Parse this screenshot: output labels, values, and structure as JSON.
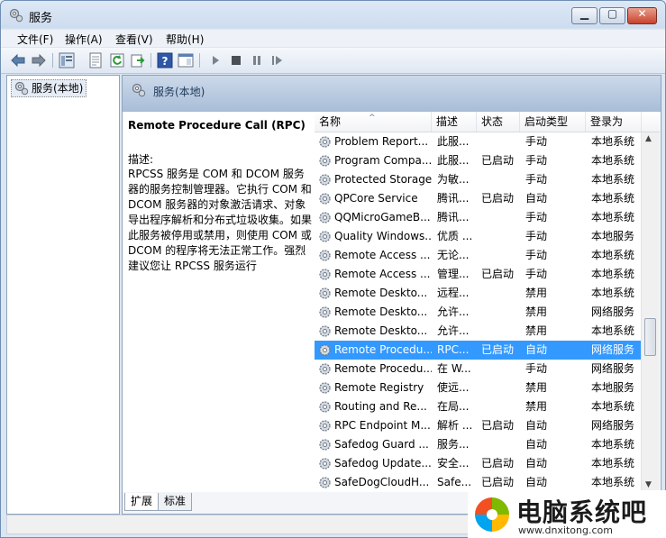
{
  "window": {
    "title": "服务"
  },
  "menu": [
    "文件(F)",
    "操作(A)",
    "查看(V)",
    "帮助(H)"
  ],
  "tree": {
    "label": "服务(本地)"
  },
  "pane_header": "服务(本地)",
  "description": {
    "title": "Remote Procedure Call (RPC)",
    "label": "描述:",
    "body": "RPCSS 服务是 COM 和 DCOM 服务器的服务控制管理器。它执行 COM 和 DCOM 服务器的对象激活请求、对象导出程序解析和分布式垃圾收集。如果此服务被停用或禁用，则使用 COM 或 DCOM 的程序将无法正常工作。强烈建议您让 RPCSS 服务运行"
  },
  "columns": {
    "name": "名称",
    "desc": "描述",
    "status": "状态",
    "startup": "启动类型",
    "logon": "登录为"
  },
  "rows": [
    {
      "name": "Problem Report...",
      "desc": "此服...",
      "status": "",
      "startup": "手动",
      "logon": "本地系统"
    },
    {
      "name": "Program Compa...",
      "desc": "此服...",
      "status": "已启动",
      "startup": "手动",
      "logon": "本地系统"
    },
    {
      "name": "Protected Storage",
      "desc": "为敏...",
      "status": "",
      "startup": "手动",
      "logon": "本地系统"
    },
    {
      "name": "QPCore Service",
      "desc": "腾讯...",
      "status": "已启动",
      "startup": "自动",
      "logon": "本地系统"
    },
    {
      "name": "QQMicroGameB...",
      "desc": "腾讯...",
      "status": "",
      "startup": "手动",
      "logon": "本地系统"
    },
    {
      "name": "Quality Windows...",
      "desc": "优质 ...",
      "status": "",
      "startup": "手动",
      "logon": "本地服务"
    },
    {
      "name": "Remote Access ...",
      "desc": "无论...",
      "status": "",
      "startup": "手动",
      "logon": "本地系统"
    },
    {
      "name": "Remote Access ...",
      "desc": "管理...",
      "status": "已启动",
      "startup": "手动",
      "logon": "本地系统"
    },
    {
      "name": "Remote Deskto...",
      "desc": "远程...",
      "status": "",
      "startup": "禁用",
      "logon": "本地系统"
    },
    {
      "name": "Remote Deskto...",
      "desc": "允许...",
      "status": "",
      "startup": "禁用",
      "logon": "网络服务"
    },
    {
      "name": "Remote Deskto...",
      "desc": "允许...",
      "status": "",
      "startup": "禁用",
      "logon": "本地系统"
    },
    {
      "name": "Remote Procedu...",
      "desc": "RPC...",
      "status": "已启动",
      "startup": "自动",
      "logon": "网络服务",
      "selected": true
    },
    {
      "name": "Remote Procedu...",
      "desc": "在 W...",
      "status": "",
      "startup": "手动",
      "logon": "网络服务"
    },
    {
      "name": "Remote Registry",
      "desc": "使远...",
      "status": "",
      "startup": "禁用",
      "logon": "本地服务"
    },
    {
      "name": "Routing and Re...",
      "desc": "在局...",
      "status": "",
      "startup": "禁用",
      "logon": "本地系统"
    },
    {
      "name": "RPC Endpoint M...",
      "desc": "解析 ...",
      "status": "已启动",
      "startup": "自动",
      "logon": "网络服务"
    },
    {
      "name": "Safedog Guard ...",
      "desc": "服务...",
      "status": "",
      "startup": "自动",
      "logon": "本地系统"
    },
    {
      "name": "Safedog Update...",
      "desc": "安全...",
      "status": "已启动",
      "startup": "自动",
      "logon": "本地系统"
    },
    {
      "name": "SafeDogCloudH...",
      "desc": "Safe...",
      "status": "已启动",
      "startup": "自动",
      "logon": "本地系统"
    }
  ],
  "tabs": [
    "扩展",
    "标准"
  ],
  "watermark": {
    "main": "电脑系统吧",
    "sub": "www.dnxitong.com"
  },
  "colors": {
    "selection": "#3399ff",
    "header": "#a8bdd7"
  }
}
